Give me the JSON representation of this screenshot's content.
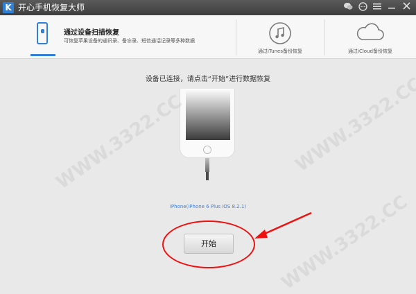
{
  "app": {
    "logo_letter": "K",
    "title": "开心手机恢复大师",
    "titlebar_icons": [
      "wechat-icon",
      "chat-icon",
      "menu-icon",
      "minimize-icon",
      "close-icon"
    ]
  },
  "tabs": {
    "device_scan": {
      "title": "通过设备扫描恢复",
      "description": "可恢复苹果设备的通讯录、备忘录、短信通话记录等多种数据",
      "icon": "phone-icon",
      "active": true
    },
    "itunes": {
      "label": "通过iTunes备份恢复",
      "icon": "music-note-icon"
    },
    "icloud": {
      "label": "通过iCloud备份恢复",
      "icon": "cloud-icon"
    }
  },
  "main": {
    "instruction": "设备已连接，请点击“开始”进行数据恢复",
    "device_name": "iPhone(iPhone 6 Plus iOS 8.2.1)",
    "start_button": "开始"
  },
  "watermark": "WWW.3322.CC",
  "colors": {
    "accent": "#2f7fd6",
    "annotation_red": "#e11111",
    "titlebar": "#4a4a4a",
    "background": "#e9e9e9"
  }
}
